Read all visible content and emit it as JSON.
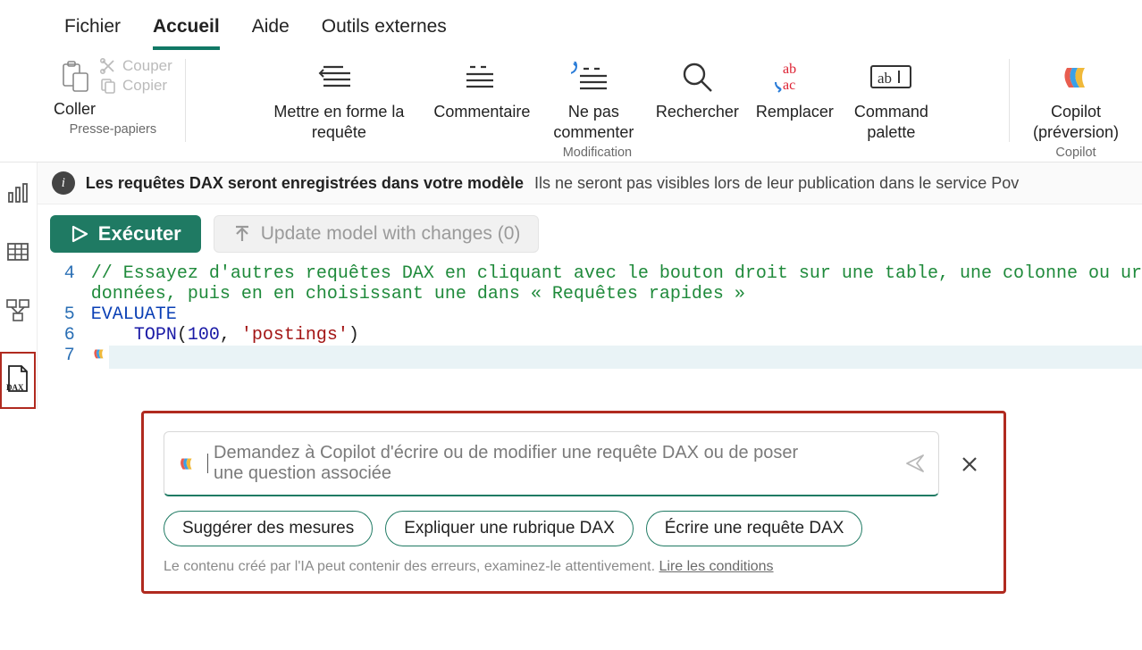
{
  "tabs": {
    "file": "Fichier",
    "home": "Accueil",
    "help": "Aide",
    "external": "Outils externes"
  },
  "ribbon": {
    "clipboard": {
      "paste": "Coller",
      "cut": "Couper",
      "copy": "Copier",
      "group_label": "Presse-papiers"
    },
    "edit": {
      "format": "Mettre en forme la requête",
      "comment": "Commentaire",
      "uncomment": "Ne pas commenter",
      "find": "Rechercher",
      "replace": "Remplacer",
      "palette": "Command palette",
      "group_label": "Modification"
    },
    "copilot": {
      "button": "Copilot (préversion)",
      "group_label": "Copilot"
    }
  },
  "infobar": {
    "bold": "Les requêtes DAX seront enregistrées dans votre modèle",
    "rest": "Ils ne seront pas visibles lors de leur publication dans le service Pov"
  },
  "toolbar": {
    "execute": "Exécuter",
    "update": "Update model with changes (0)"
  },
  "editor": {
    "lines": {
      "4": "4",
      "5": "5",
      "6": "6",
      "7": "7"
    },
    "comment_line1": "// Essayez d'autres requêtes DAX en cliquant avec le bouton droit sur une table, une colonne ou ur",
    "comment_line2": "données, puis en en choisissant une dans « Requêtes rapides »",
    "evaluate": "EVALUATE",
    "topn_fn": "TOPN",
    "topn_open": "(",
    "topn_num": "100",
    "topn_sep": ", ",
    "topn_str": "'postings'",
    "topn_close": ")"
  },
  "copilot_panel": {
    "placeholder": "Demandez à Copilot d'écrire ou de modifier une requête DAX ou de poser une question associée",
    "chip1": "Suggérer des mesures",
    "chip2": "Expliquer une rubrique DAX",
    "chip3": "Écrire une requête DAX",
    "disclaimer": "Le contenu créé par l'IA peut contenir des erreurs, examinez-le attentivement.",
    "terms": "Lire les conditions"
  },
  "siderail": {
    "report": "report-view-icon",
    "table": "table-view-icon",
    "model": "model-view-icon",
    "dax": "dax-query-view-icon"
  }
}
